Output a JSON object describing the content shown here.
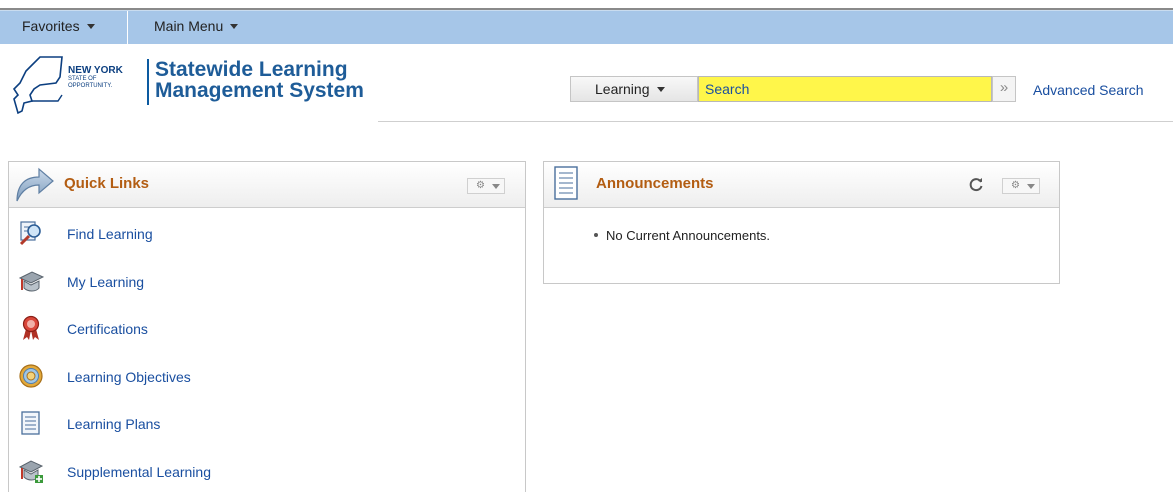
{
  "menubar": {
    "favorites": "Favorites",
    "main_menu": "Main Menu"
  },
  "logo": {
    "state_line1": "NEW YORK",
    "state_line2": "STATE OF",
    "state_line3": "OPPORTUNITY.",
    "title_line1": "Statewide Learning",
    "title_line2": "Management System"
  },
  "search": {
    "category": "Learning",
    "placeholder": "Search",
    "go_symbol": "»",
    "advanced_label": "Advanced Search",
    "highlight_color": "#fff64a"
  },
  "quick_links": {
    "title": "Quick Links",
    "items": [
      {
        "label": "Find Learning",
        "icon": "find-learning-icon"
      },
      {
        "label": "My Learning",
        "icon": "graduation-cap-icon"
      },
      {
        "label": "Certifications",
        "icon": "award-ribbon-icon"
      },
      {
        "label": "Learning Objectives",
        "icon": "target-icon"
      },
      {
        "label": "Learning Plans",
        "icon": "checklist-icon"
      },
      {
        "label": "Supplemental Learning",
        "icon": "graduation-cap-add-icon"
      }
    ]
  },
  "announcements": {
    "title": "Announcements",
    "items": [
      "No Current Announcements."
    ]
  },
  "colors": {
    "menubar": "#a6c6e8",
    "pagelet_title": "#b35d12",
    "link": "#1a4fa0",
    "logo_blue": "#1e5c98"
  }
}
